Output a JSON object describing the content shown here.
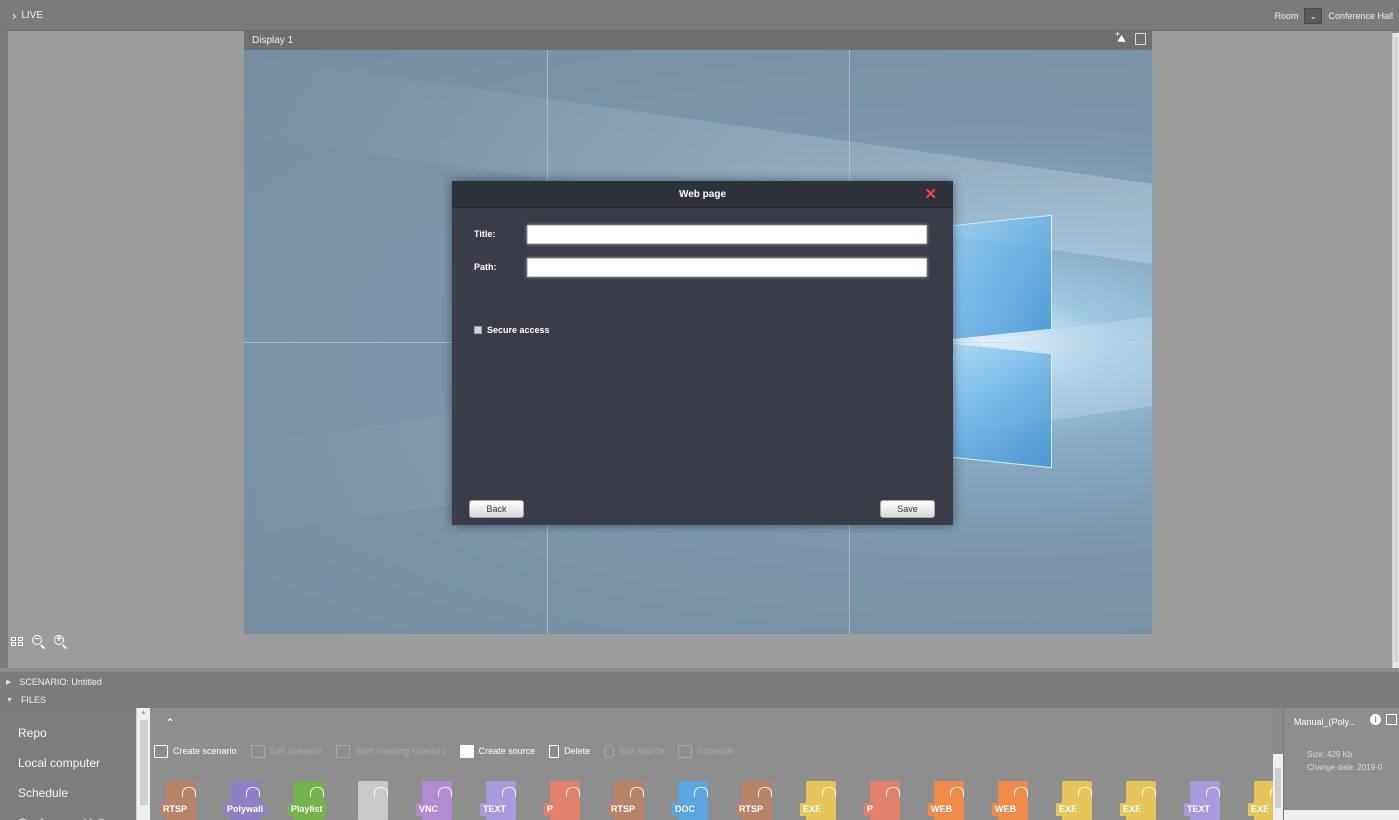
{
  "topbar": {
    "live_label": "LIVE",
    "room_label": "Room",
    "room_value": "Conference Hall"
  },
  "display": {
    "title": "Display 1"
  },
  "dialog": {
    "title": "Web page",
    "title_label": "Title:",
    "title_value": "",
    "path_label": "Path:",
    "path_value": "",
    "secure_label": "Secure access",
    "secure_checked": false,
    "back_label": "Back",
    "save_label": "Save"
  },
  "sections": {
    "scenario_label": "SCENARIO: Untitled",
    "files_label": "FILES"
  },
  "nav": {
    "items": [
      {
        "label": "Repo"
      },
      {
        "label": "Local computer"
      },
      {
        "label": "Schedule"
      },
      {
        "label": "Conference Hall"
      }
    ]
  },
  "toolbar": {
    "create_scenario": "Create scenario",
    "edit_scenario": "Edit scenario",
    "start_showing": "Start showing scenario",
    "create_source": "Create source",
    "delete": "Delete",
    "edit_source": "Edit source",
    "schedule": "Schedule"
  },
  "files": [
    {
      "tag": "RTSP",
      "color": "#b98367",
      "icon": "rtsp-file-icon"
    },
    {
      "tag": "Polywall",
      "color": "#8f7fc4",
      "icon": "polywall-file-icon"
    },
    {
      "tag": "Playlist",
      "color": "#74b24a",
      "icon": "playlist-file-icon"
    },
    {
      "tag": "",
      "color": "#c9c9c9",
      "icon": "video-file-icon"
    },
    {
      "tag": "VNC",
      "color": "#b48ad3",
      "icon": "vnc-file-icon"
    },
    {
      "tag": "TEXT",
      "color": "#a99adf",
      "icon": "text-file-icon"
    },
    {
      "tag": "P",
      "color": "#e3826c",
      "icon": "powerpoint-file-icon"
    },
    {
      "tag": "RTSP",
      "color": "#b98367",
      "icon": "rtsp-file-icon"
    },
    {
      "tag": "DOC",
      "color": "#5aa6e0",
      "icon": "doc-file-icon"
    },
    {
      "tag": "RTSP",
      "color": "#b98367",
      "icon": "rtsp-file-icon"
    },
    {
      "tag": "EXE",
      "color": "#e6c457",
      "icon": "exe-file-icon"
    },
    {
      "tag": "P",
      "color": "#e3826c",
      "icon": "powerpoint-file-icon"
    },
    {
      "tag": "WEB",
      "color": "#f08c4a",
      "icon": "web-file-icon"
    },
    {
      "tag": "WEB",
      "color": "#f08c4a",
      "icon": "web-file-icon"
    },
    {
      "tag": "EXE",
      "color": "#e6c457",
      "icon": "exe-file-icon"
    },
    {
      "tag": "EXE",
      "color": "#e6c457",
      "icon": "exe-file-icon"
    },
    {
      "tag": "TEXT",
      "color": "#a99adf",
      "icon": "text-file-icon"
    },
    {
      "tag": "EXE",
      "color": "#e6c457",
      "icon": "exe-file-icon"
    }
  ],
  "preview": {
    "title": "Manual_(Poly...",
    "size": "Size: 429 Kb",
    "change_date": "Change date: 2019-0"
  },
  "colors": {
    "close_accent": "#ff3d3d",
    "dialog_bg": "#3a3d48"
  }
}
